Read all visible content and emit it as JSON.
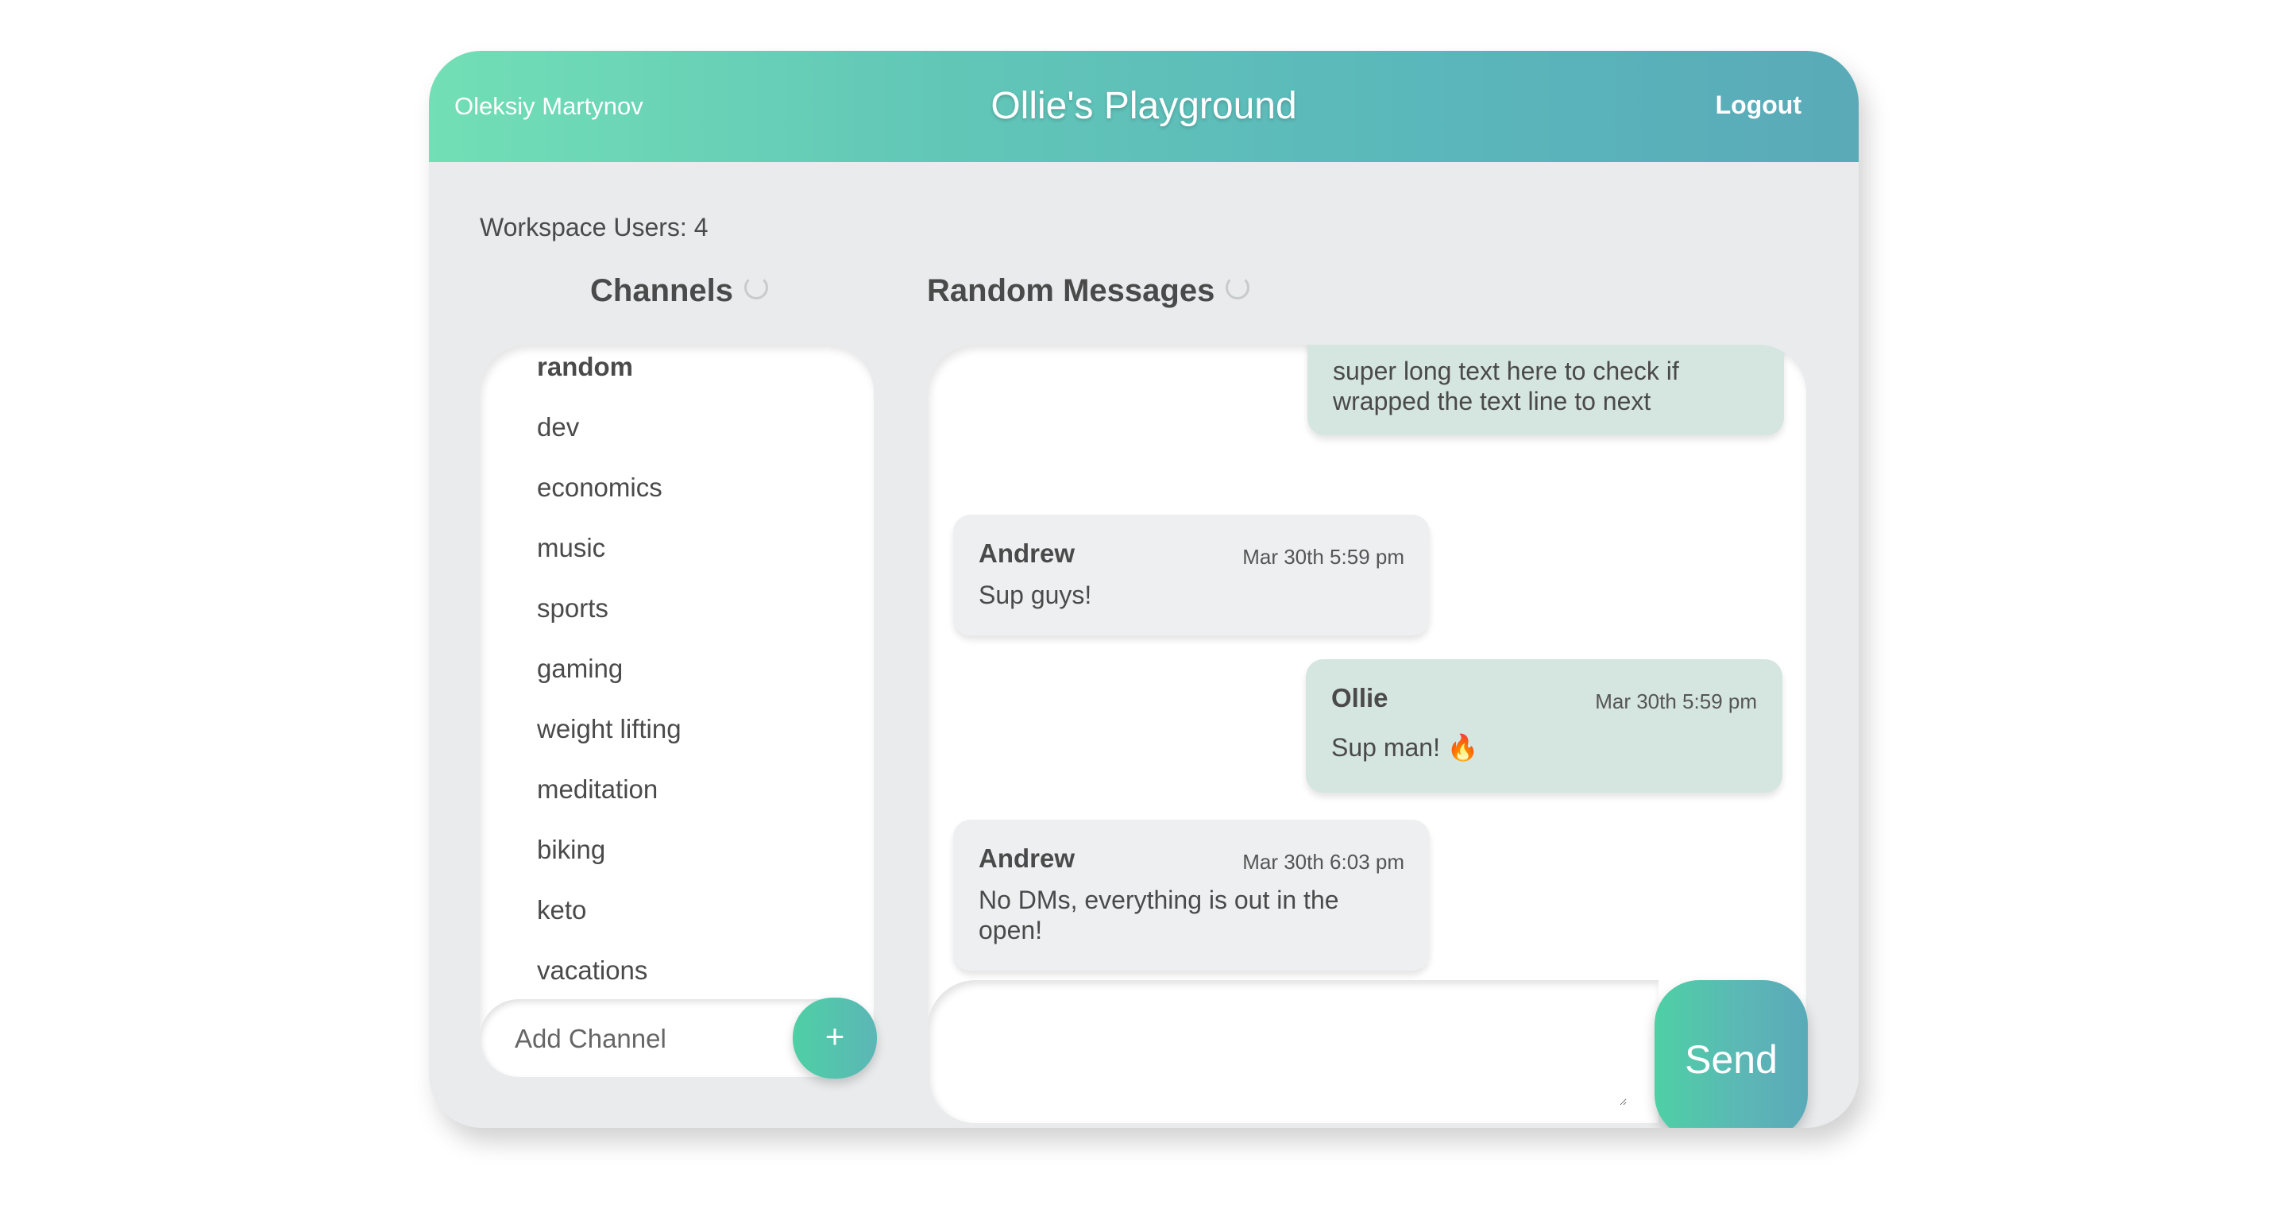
{
  "header": {
    "user_name": "Oleksiy Martynov",
    "title": "Ollie's Playground",
    "logout_label": "Logout"
  },
  "workspace": {
    "users_label": "Workspace Users: 4"
  },
  "channels": {
    "title": "Channels",
    "items": [
      "random",
      "dev",
      "economics",
      "music",
      "sports",
      "gaming",
      "weight lifting",
      "meditation",
      "biking",
      "keto",
      "vacations"
    ],
    "active": "random",
    "add_placeholder": "Add Channel",
    "add_label": "+"
  },
  "messages": {
    "title": "Random Messages",
    "items": [
      {
        "author": "",
        "time": "",
        "text": "super long text here to check if wrapped the text line to next",
        "mine": true
      },
      {
        "author": "Andrew",
        "time": "Mar 30th 5:59 pm",
        "text": "Sup guys!",
        "mine": false
      },
      {
        "author": "Ollie",
        "time": "Mar 30th 5:59 pm",
        "text": "Sup man! 🔥",
        "mine": true
      },
      {
        "author": "Andrew",
        "time": "Mar 30th 6:03 pm",
        "text": "No DMs, everything is out in the open!",
        "mine": false
      }
    ],
    "send_label": "Send"
  },
  "colors": {
    "accent_start": "#72dfb6",
    "accent_end": "#5aaab8",
    "mine_bubble": "#d5e5e0",
    "their_bubble": "#eeeff0"
  }
}
